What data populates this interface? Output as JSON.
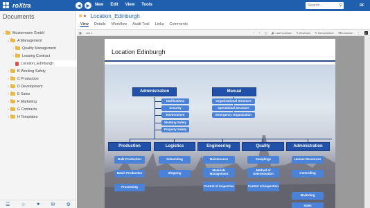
{
  "app": {
    "name": "roXtra",
    "brand_color": "#1f5fae"
  },
  "topbar": {
    "nav_back_icon": "arrow-left-icon",
    "nav_forward_icon": "arrow-right-icon",
    "menu": [
      "New",
      "Edit",
      "View",
      "Tools"
    ],
    "search_placeholder": "Search...",
    "user_initials": "RF"
  },
  "sidebar": {
    "title": "Documents",
    "items": [
      {
        "label": "Mustermann GmbH",
        "type": "folder",
        "expanded": true
      },
      {
        "label": "A Management",
        "type": "folder",
        "expanded": true
      },
      {
        "label": "Quality Management",
        "type": "folder",
        "expanded": false
      },
      {
        "label": "Leasing Contract",
        "type": "folder",
        "expanded": false
      },
      {
        "label": "Location_Edinburgh",
        "type": "document"
      },
      {
        "label": "B Working Safety",
        "type": "folder",
        "expanded": false
      },
      {
        "label": "C Production",
        "type": "folder",
        "expanded": false
      },
      {
        "label": "D Development",
        "type": "folder",
        "expanded": false
      },
      {
        "label": "E Sales",
        "type": "folder",
        "expanded": false
      },
      {
        "label": "F Marketing",
        "type": "folder",
        "expanded": false
      },
      {
        "label": "G Contracts",
        "type": "folder",
        "expanded": false
      },
      {
        "label": "H Templates",
        "type": "folder",
        "expanded": false
      }
    ]
  },
  "document": {
    "title": "Location_Edinburgh",
    "tabs": [
      "View",
      "Details",
      "Workflow",
      "Audit Trail",
      "Links",
      "Comments"
    ],
    "active_tab": "View",
    "toolbar": {
      "page_info": "von 1",
      "read_aloud": "Laut vorlesen",
      "draw": "Zeichnen",
      "highlight": "Hervorheben",
      "delete": "Löschen"
    },
    "page_heading": "Location Edinburgh",
    "org_chart": {
      "top_left": {
        "label": "Administration",
        "children": [
          "Notifications",
          "Security",
          "Environment",
          "Working Safety",
          "Property Safety"
        ]
      },
      "top_right": {
        "label": "Manual",
        "children": [
          "Organisational Structure",
          "Operational Structure",
          "Emergency Organisation"
        ]
      },
      "departments": [
        {
          "label": "Production",
          "children": [
            "Bulk Production",
            "Batch Production",
            "Processing"
          ]
        },
        {
          "label": "Logistics",
          "children": [
            "Scheduling",
            "Shipping"
          ]
        },
        {
          "label": "Engineering",
          "children": [
            "Maintenance",
            "Materials Management",
            "Control of Inspection"
          ]
        },
        {
          "label": "Quality",
          "children": [
            "Samplings",
            "Method of Determination",
            "Control of Inspection"
          ]
        },
        {
          "label": "Administration",
          "children": [
            "Human Resources",
            "Controlling",
            "Marketing",
            "Sales"
          ]
        }
      ]
    }
  }
}
